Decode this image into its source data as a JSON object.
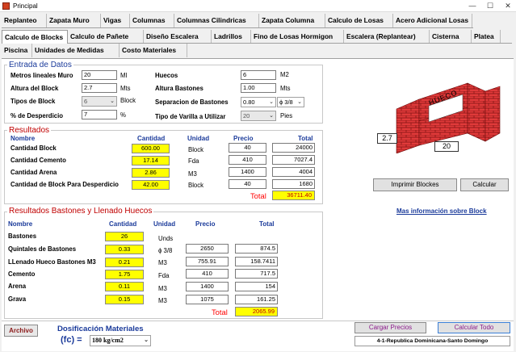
{
  "window": {
    "title": "Principal"
  },
  "tabs_row1": [
    "Replanteo",
    "Zapata Muro",
    "Vigas",
    "Columnas",
    "Columnas Cilindricas",
    "Zapata Columna",
    "Calculo de Losas",
    "Acero Adicional Losas"
  ],
  "tabs_row2": [
    "Calculo de Blocks",
    "Calculo de Pañete",
    "Diseño Escalera",
    "Ladrillos",
    "Fino de Losas Hormigon",
    "Escalera (Replantear)",
    "Cisterna",
    "Platea"
  ],
  "tabs_row3": [
    "Piscina",
    "Unidades de Medidas",
    "Costo Materiales"
  ],
  "entrada": {
    "title": "Entrada de Datos",
    "metros_label": "Metros lineales Muro",
    "metros_value": "20",
    "metros_unit": "Ml",
    "altura_label": "Altura del Block",
    "altura_value": "2.7",
    "altura_unit": "Mts",
    "tipos_label": "Tipos de Block",
    "tipos_value": "6",
    "tipos_unit": "Block",
    "desperdicio_label": "% de Desperdicio",
    "desperdicio_value": "7",
    "desperdicio_unit": "%",
    "huecos_label": "Huecos",
    "huecos_value": "6",
    "huecos_unit": "M2",
    "altura_bastones_label": "Altura Bastones",
    "altura_bastones_value": "1.00",
    "altura_bastones_unit": "Mts",
    "separacion_label": "Separacion de Bastones",
    "separacion_value": "0.80",
    "separacion_value2": "ϕ 3/8",
    "tipo_varilla_label": "Tipo de Varilla a Utilizar",
    "tipo_varilla_value": "20",
    "tipo_varilla_unit": "Pies"
  },
  "resultados": {
    "title": "Resultados",
    "headers": {
      "nombre": "Nombre",
      "cantidad": "Cantidad",
      "unidad": "Unidad",
      "precio": "Precio",
      "total": "Total"
    },
    "rows": [
      {
        "nombre": "Cantidad Block",
        "cantidad": "600.00",
        "unidad": "Block",
        "precio": "40",
        "total": "24000"
      },
      {
        "nombre": "Cantidad Cemento",
        "cantidad": "17.14",
        "unidad": "Fda",
        "precio": "410",
        "total": "7027.4"
      },
      {
        "nombre": "Cantidad Arena",
        "cantidad": "2.86",
        "unidad": "M3",
        "precio": "1400",
        "total": "4004"
      },
      {
        "nombre": "Cantidad de Block Para Desperdicio",
        "cantidad": "42.00",
        "unidad": "Block",
        "precio": "40",
        "total": "1680"
      }
    ],
    "total_label": "Total",
    "total_value": "36711.40"
  },
  "bastones": {
    "title": "Resultados Bastones y Llenado Huecos",
    "headers": {
      "nombre": "Nombre",
      "cantidad": "Cantidad",
      "unidad": "Unidad",
      "precio": "Precio",
      "total": "Total"
    },
    "rows": [
      {
        "nombre": "Bastones",
        "cantidad": "26",
        "unidad": "Unds",
        "precio": "",
        "total": ""
      },
      {
        "nombre": "Quintales de Bastones",
        "cantidad": "0.33",
        "unidad": "ϕ 3/8",
        "precio": "2650",
        "total": "874.5"
      },
      {
        "nombre": "LLenado Hueco Bastones M3",
        "cantidad": "0.21",
        "unidad": "M3",
        "precio": "755.91",
        "total": "158.7411"
      },
      {
        "nombre": "Cemento",
        "cantidad": "1.75",
        "unidad": "Fda",
        "precio": "410",
        "total": "717.5"
      },
      {
        "nombre": "Arena",
        "cantidad": "0.11",
        "unidad": "M3",
        "precio": "1400",
        "total": "154"
      },
      {
        "nombre": "Grava",
        "cantidad": "0.15",
        "unidad": "M3",
        "precio": "1075",
        "total": "161.25"
      }
    ],
    "total_label": "Total",
    "total_value": "2065.99"
  },
  "diagram": {
    "hueco_label": "HUECO",
    "height_label": "2.7",
    "length_label": "20"
  },
  "buttons": {
    "imprimir": "Imprimir Blockes",
    "calcular": "Calcular",
    "mas_info": "Mas información sobre Block",
    "archivo": "Archivo",
    "cargar_precios": "Cargar Precios",
    "calcular_todo": "Calcular Todo"
  },
  "dosificacion": {
    "title": "Dosificación Materiales",
    "fc_label": "(fc) =",
    "fc_value": "180 kg/cm2"
  },
  "footer": {
    "region": "4-1-Republica Dominicana-Santo Domingo"
  },
  "colors": {
    "accent_blue": "#1a3a9a",
    "accent_red": "#c00000",
    "highlight_yellow": "#ffff00"
  }
}
